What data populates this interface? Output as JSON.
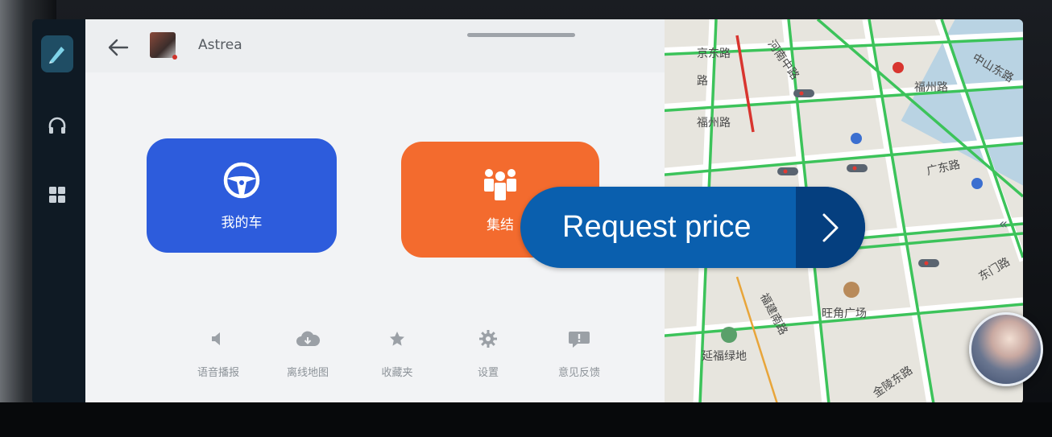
{
  "header": {
    "username": "Astrea"
  },
  "tiles": [
    {
      "label": "我的车",
      "icon": "steering-wheel-icon",
      "color": "#2d5cdc"
    },
    {
      "label": "集结",
      "icon": "group-people-icon",
      "color": "#f36b2e"
    }
  ],
  "quick_actions": [
    {
      "label": "语音播报",
      "icon": "speaker-icon"
    },
    {
      "label": "离线地图",
      "icon": "cloud-download-icon"
    },
    {
      "label": "收藏夹",
      "icon": "star-icon"
    },
    {
      "label": "设置",
      "icon": "gear-icon"
    },
    {
      "label": "意见反馈",
      "icon": "feedback-icon"
    }
  ],
  "map": {
    "labels": {
      "nanjing_dong": "京东路",
      "lu": "路",
      "fuzhou_left": "福州路",
      "fuzhou_right": "福州路",
      "guangdong": "广东路",
      "fujian_nan": "福建南路",
      "wangjiao": "旺角广场",
      "yanfu": "延福绿地",
      "jinling_dong": "金陵东路",
      "dongmen": "东门路",
      "zhongshan_dong": "中山东路",
      "henan_zhong": "河南中路"
    }
  },
  "cta": {
    "label": "Request price"
  },
  "colors": {
    "cta_blue": "#0a5fae",
    "cta_dark": "#053f7f",
    "road_green": "#3cc35a",
    "road_red": "#d8352f"
  }
}
